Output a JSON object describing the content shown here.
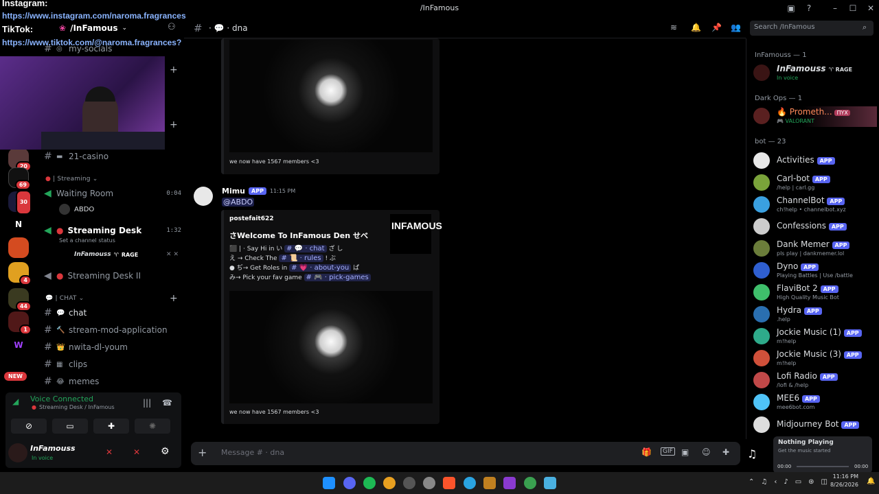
{
  "window": {
    "title": "/InFamous"
  },
  "overlay": {
    "instagram_label": "Instagram:",
    "instagram_url": "https://www.instagram.com/naroma.fragrances",
    "tiktok_label": "TikTok:",
    "tiktok_url": "https://www.tiktok.com/@naroma.fragrances?"
  },
  "server": {
    "name": "/InFamous"
  },
  "rail_badges": [
    "20",
    "69",
    "30",
    "4",
    "44",
    "1"
  ],
  "rail_new": "NEW",
  "channels": {
    "partial_top": "my-socials",
    "casino": "21-casino",
    "streaming_category": "| Streaming",
    "waiting_room": "Waiting Room",
    "waiting_time": "0:04",
    "waiting_user": "ABDO",
    "streaming_desk": "Streaming Desk",
    "streaming_desk_time": "1:32",
    "channel_status": "Set a channel status",
    "desk_user": "InFamouss",
    "desk_user_tag": "RAGE",
    "streaming_desk_2": "Streaming Desk II",
    "chat_category": "| CHAT",
    "text_channels": [
      "chat",
      "stream-mod-application",
      "nwita-dl-youm",
      "clips",
      "memes"
    ]
  },
  "voice": {
    "status": "Voice Connected",
    "location": "Streaming Desk / InFamous"
  },
  "user": {
    "name": "InFamouss",
    "status": "In voice"
  },
  "chat_header": {
    "channel": "dna",
    "search_placeholder": "Search /InFamous"
  },
  "messages": {
    "embed1_footer": "we now have 1567 members <3",
    "author": "Mimu",
    "app_tag": "APP",
    "time": "11:15 PM",
    "mention": "@ABDO",
    "embed2": {
      "author": "postefait622",
      "title": "Welcome To InFamous Den",
      "logo_text": "INFAMOUS",
      "lines": [
        {
          "prefix": "Say Hi in",
          "chip": "chat"
        },
        {
          "prefix": "Check The",
          "chip": "rules"
        },
        {
          "prefix": "Get Roles in",
          "chip": "about-you"
        },
        {
          "prefix": "Pick your fav game",
          "chip": "pick-games"
        }
      ],
      "footer": "we now have 1567 members <3"
    }
  },
  "input": {
    "placeholder": "Message # · dna"
  },
  "members": {
    "group1": "InFamouss — 1",
    "m1": {
      "name": "InFamouss",
      "tag": "RAGE",
      "status": "In voice"
    },
    "group2": "Dark Ops — 1",
    "m2": {
      "name": "Prometh...",
      "tag": "ПYX",
      "status": "VALORANT"
    },
    "group3": "bot — 23",
    "bots": [
      {
        "name": "Activities",
        "status": "",
        "color": "#e8e8e8"
      },
      {
        "name": "Carl-bot",
        "status": "/help | carl.gg",
        "color": "#7aa33a"
      },
      {
        "name": "ChannelBot",
        "status": "ch!help • channelbot.xyz",
        "color": "#3aa0e0"
      },
      {
        "name": "Confessions",
        "status": "",
        "color": "#cccccc"
      },
      {
        "name": "Dank Memer",
        "status": "pls play | dankmemer.lol",
        "color": "#6b7d3a"
      },
      {
        "name": "Dyno",
        "status": "Playing Battles | Use /battle",
        "color": "#2f5fd0"
      },
      {
        "name": "FlaviBot 2",
        "status": "High Quality Music Bot",
        "color": "#3fbf6b"
      },
      {
        "name": "Hydra",
        "status": ".help",
        "color": "#2a6fb0"
      },
      {
        "name": "Jockie Music (1)",
        "status": "m!help",
        "color": "#2eaa8a"
      },
      {
        "name": "Jockie Music (3)",
        "status": "m!help",
        "color": "#d0503a"
      },
      {
        "name": "Lofi Radio",
        "status": "/lofi & /help",
        "color": "#c04848"
      },
      {
        "name": "MEE6",
        "status": "mee6bot.com",
        "color": "#4fc3f7"
      },
      {
        "name": "Midjourney Bot",
        "status": "",
        "color": "#dddddd"
      }
    ]
  },
  "now_playing": {
    "title": "Nothing Playing",
    "subtitle": "Get the music started",
    "time_start": "00:00",
    "time_end": "00:00"
  },
  "taskbar": {
    "time": "11:16 PM",
    "date": "8/26/2026"
  }
}
